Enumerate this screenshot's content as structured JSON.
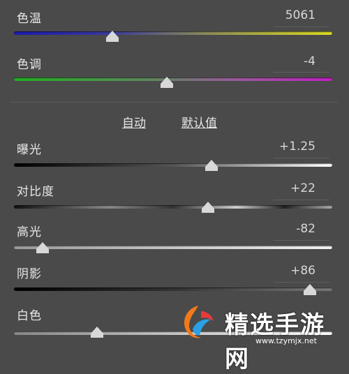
{
  "panel": {
    "auto_link": "自动",
    "default_link": "默认值",
    "sliders": [
      {
        "id": "temp",
        "label": "色温",
        "value": "5061",
        "position": 0.31
      },
      {
        "id": "tint",
        "label": "色调",
        "value": "-4",
        "position": 0.48
      },
      {
        "id": "exposure",
        "label": "曝光",
        "value": "+1.25",
        "position": 0.62
      },
      {
        "id": "contrast",
        "label": "对比度",
        "value": "+22",
        "position": 0.61
      },
      {
        "id": "highlights",
        "label": "高光",
        "value": "-82",
        "position": 0.09
      },
      {
        "id": "shadows",
        "label": "阴影",
        "value": "+86",
        "position": 0.93
      },
      {
        "id": "whites",
        "label": "白色",
        "value": "",
        "position": 0.26
      }
    ]
  },
  "watermark": {
    "title": "精选手游网",
    "url": "www.tzymjx.net",
    "colors": {
      "orange": "#f07a1a",
      "blue": "#2aa0e6",
      "red": "#e83a3a"
    }
  }
}
